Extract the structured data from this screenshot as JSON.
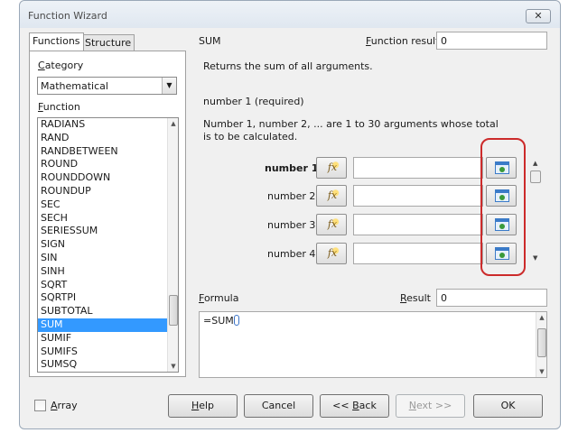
{
  "window": {
    "title": "Function Wizard",
    "close_label": "✕"
  },
  "tabs": [
    {
      "label": "Functions"
    },
    {
      "label": "Structure"
    }
  ],
  "category": {
    "label_first": "C",
    "label_rest": "ategory",
    "selected": "Mathematical"
  },
  "function_label": {
    "first": "F",
    "rest": "unction"
  },
  "functions": [
    "RADIANS",
    "RAND",
    "RANDBETWEEN",
    "ROUND",
    "ROUNDDOWN",
    "ROUNDUP",
    "SEC",
    "SECH",
    "SERIESSUM",
    "SIGN",
    "SIN",
    "SINH",
    "SQRT",
    "SQRTPI",
    "SUBTOTAL",
    "SUM",
    "SUMIF",
    "SUMIFS",
    "SUMSQ"
  ],
  "selected_function": "SUM",
  "detail": {
    "name": "SUM",
    "function_result_label_first": "F",
    "function_result_label_rest": "unction result",
    "function_result_value": "0",
    "description": "Returns the sum of all arguments.",
    "param_title": "number 1 (required)",
    "param_description": "Number 1, number 2, ... are 1 to 30 arguments whose total is to be calculated.",
    "args": [
      {
        "label": "number 1",
        "value": ""
      },
      {
        "label": "number 2",
        "value": ""
      },
      {
        "label": "number 3",
        "value": ""
      },
      {
        "label": "number 4",
        "value": ""
      }
    ]
  },
  "formula": {
    "label_first": "F",
    "label_rest": "ormula",
    "result_label_first": "R",
    "result_label_rest": "esult",
    "result_value": "0",
    "text": "=SUM"
  },
  "footer": {
    "array_label_first": "A",
    "array_label_rest": "rray",
    "help_first": "H",
    "help_rest": "elp",
    "cancel": "Cancel",
    "back_prefix": "<< ",
    "back_first": "B",
    "back_rest": "ack",
    "next_first": "N",
    "next_rest": "ext >>",
    "ok": "OK"
  },
  "colors": {
    "highlight": "#cc2b2b",
    "selection": "#3399ff"
  }
}
